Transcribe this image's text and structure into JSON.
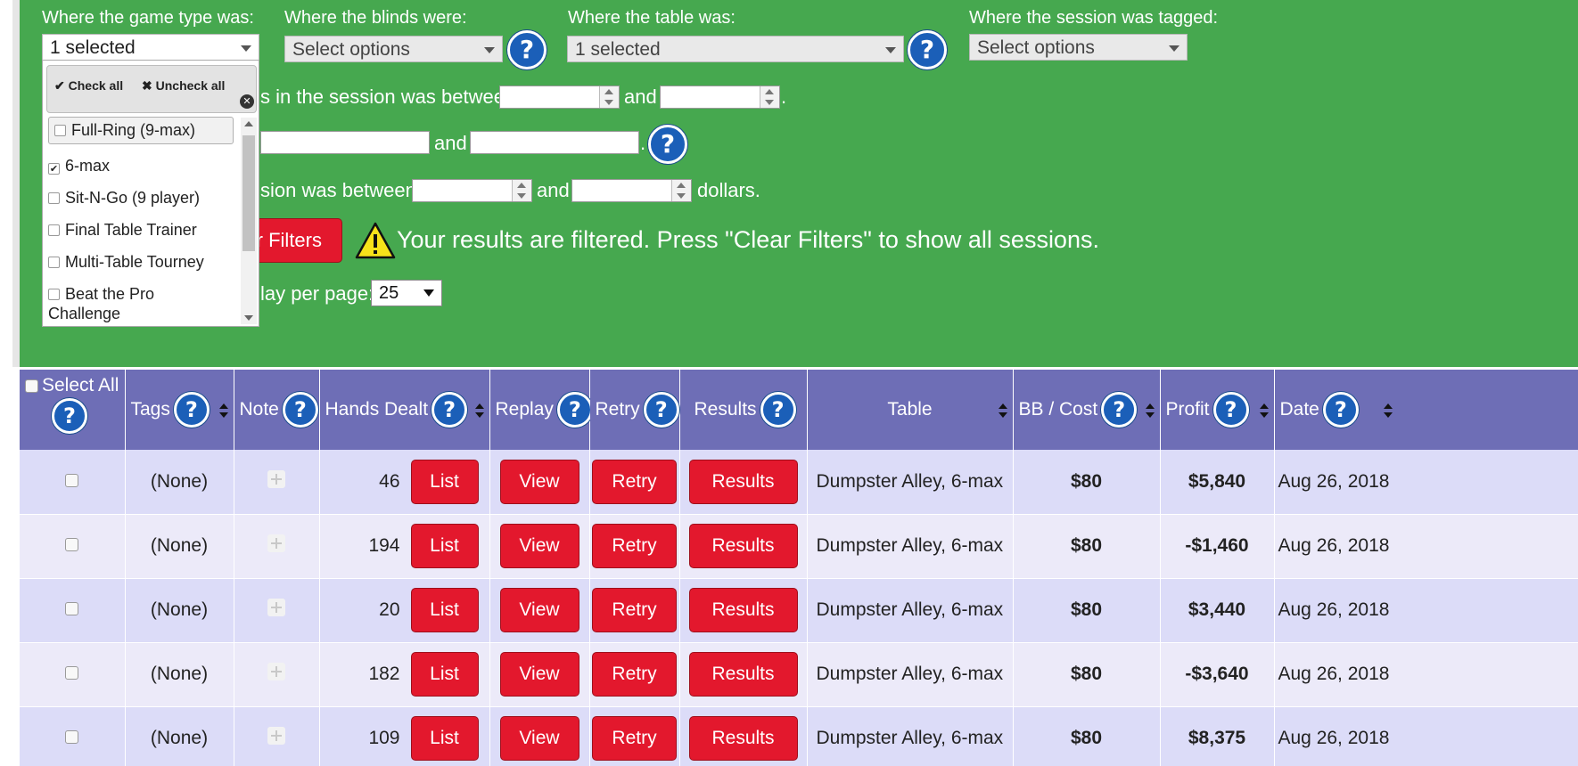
{
  "filters": {
    "game_type": {
      "label": "Where the game type was:",
      "value": "1 selected"
    },
    "blinds": {
      "label": "Where the blinds were:",
      "value": "Select options"
    },
    "table": {
      "label": "Where the table was:",
      "value": "1 selected"
    },
    "tagged": {
      "label": "Where the session was tagged:",
      "value": "Select options"
    },
    "hands_text": "s in the session was between",
    "and": "and",
    "period": ".",
    "profit_text": "sion was between",
    "dollars": "dollars.",
    "clear_button": "r Filters",
    "filtered_message": "Your results are filtered. Press \"Clear Filters\" to show all sessions.",
    "per_page_text": "lay per page:",
    "per_page_value": "25"
  },
  "dropdown": {
    "check_all": "Check all",
    "uncheck_all": "Uncheck all",
    "options": [
      {
        "label": "Full-Ring (9-max)",
        "checked": false
      },
      {
        "label": "6-max",
        "checked": true
      },
      {
        "label": "Sit-N-Go (9 player)",
        "checked": false
      },
      {
        "label": "Final Table Trainer",
        "checked": false
      },
      {
        "label": "Multi-Table Tourney",
        "checked": false
      },
      {
        "label": "Beat the Pro",
        "checked": false,
        "continuation": "Challenge"
      }
    ]
  },
  "table": {
    "headers": {
      "select_all": "Select All",
      "tags": "Tags",
      "note": "Note",
      "hands": "Hands Dealt",
      "replay": "Replay",
      "retry": "Retry",
      "results": "Results",
      "table": "Table",
      "bb_cost": "BB / Cost",
      "profit": "Profit",
      "date": "Date"
    },
    "buttons": {
      "list": "List",
      "view": "View",
      "retry": "Retry",
      "results": "Results"
    },
    "rows": [
      {
        "tags": "(None)",
        "hands": "46",
        "table": "Dumpster Alley, 6-max",
        "cost": "$80",
        "profit": "$5,840",
        "date": "Aug 26, 2018"
      },
      {
        "tags": "(None)",
        "hands": "194",
        "table": "Dumpster Alley, 6-max",
        "cost": "$80",
        "profit": "-$1,460",
        "date": "Aug 26, 2018"
      },
      {
        "tags": "(None)",
        "hands": "20",
        "table": "Dumpster Alley, 6-max",
        "cost": "$80",
        "profit": "$3,440",
        "date": "Aug 26, 2018"
      },
      {
        "tags": "(None)",
        "hands": "182",
        "table": "Dumpster Alley, 6-max",
        "cost": "$80",
        "profit": "-$3,640",
        "date": "Aug 26, 2018"
      },
      {
        "tags": "(None)",
        "hands": "109",
        "table": "Dumpster Alley, 6-max",
        "cost": "$80",
        "profit": "$8,375",
        "date": "Aug 26, 2018"
      }
    ]
  },
  "colors": {
    "panel": "#46a84f",
    "header": "#6e6eb6",
    "button": "#e3182d",
    "help": "#1b5fb8"
  }
}
